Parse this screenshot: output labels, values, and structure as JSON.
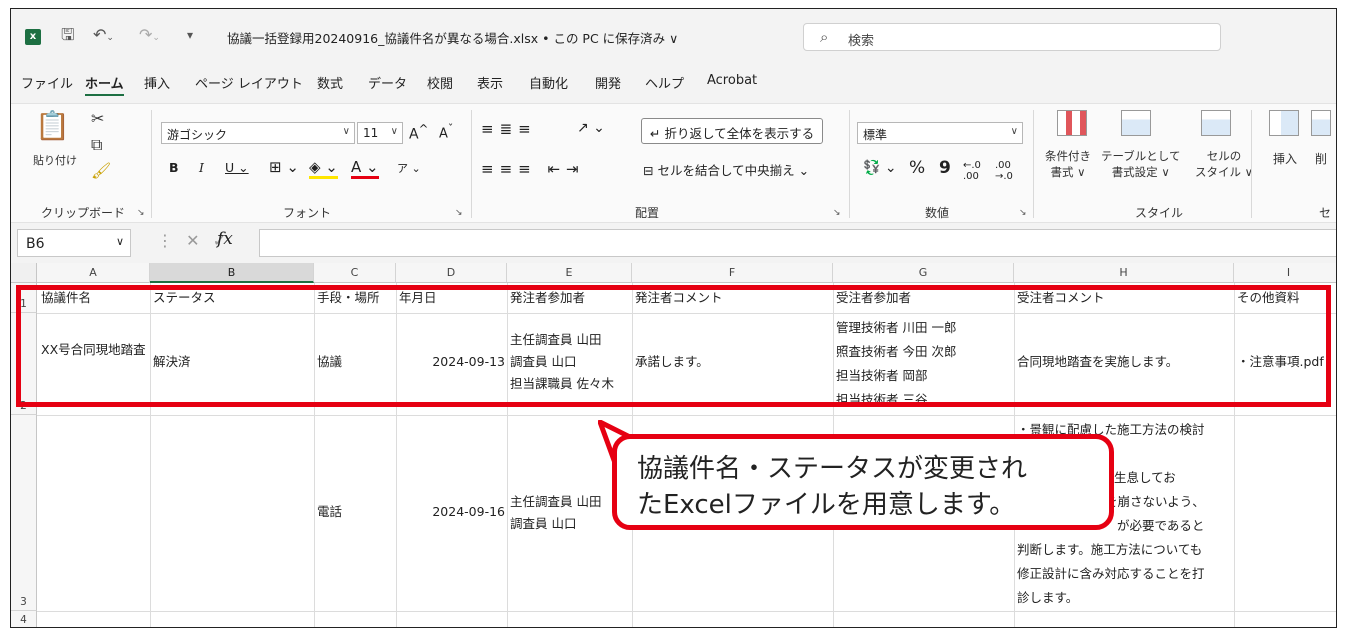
{
  "titlebar": {
    "app_icon": "excel-icon",
    "title": "協議一括登録用20240916_協議件名が異なる場合.xlsx • この PC に保存済み ∨",
    "search_placeholder": "検索"
  },
  "menu": {
    "items": [
      "ファイル",
      "ホーム",
      "挿入",
      "ページ レイアウト",
      "数式",
      "データ",
      "校閲",
      "表示",
      "自動化",
      "開発",
      "ヘルプ",
      "Acrobat"
    ],
    "active": "ホーム"
  },
  "ribbon": {
    "clipboard": {
      "paste_label": "貼り付け",
      "group_label": "クリップボード"
    },
    "font": {
      "font_name": "游ゴシック",
      "font_size": "11",
      "group_label": "フォント"
    },
    "alignment": {
      "wrap_text": "折り返して全体を表示する",
      "merge_center": "セルを結合して中央揃え",
      "group_label": "配置"
    },
    "number": {
      "format": "標準",
      "group_label": "数値"
    },
    "styles": {
      "conditional_line1": "条件付き",
      "conditional_line2": "書式 ∨",
      "table_line1": "テーブルとして",
      "table_line2": "書式設定 ∨",
      "cell_line1": "セルの",
      "cell_line2": "スタイル ∨",
      "group_label": "スタイル"
    },
    "cells": {
      "insert_label": "挿入",
      "delete_label": "削",
      "group_label": "セ"
    }
  },
  "formula_bar": {
    "name_box": "B6",
    "fx": "fx",
    "content": ""
  },
  "sheet": {
    "columns": [
      "A",
      "B",
      "C",
      "D",
      "E",
      "F",
      "G",
      "H",
      "I"
    ],
    "selected_column": "B",
    "row_numbers": [
      "1",
      "2",
      "3",
      "4"
    ],
    "header_row": [
      "協議件名",
      "ステータス",
      "手段・場所",
      "年月日",
      "発注者参加者",
      "発注者コメント",
      "受注者参加者",
      "受注者コメント",
      "その他資料"
    ],
    "row2": {
      "A": "XX号合同現地踏査",
      "B": "解決済",
      "C": "協議",
      "D": "2024-09-13",
      "E": [
        "主任調査員 山田",
        "調査員 山口",
        "担当課職員 佐々木"
      ],
      "F": "承諾します。",
      "G": [
        "管理技術者 川田 一郎",
        "照査技術者 今田 次郎",
        "担当技術者 岡部",
        "担当技術者 三谷"
      ],
      "H": "合同現地踏査を実施します。",
      "I": "・注意事項.pdf"
    },
    "row3": {
      "C": "電話",
      "D": "2024-09-16",
      "E": [
        "主任調査員 山田",
        "調査員 山口"
      ],
      "H": [
        "・景観に配慮した施工方法の検討",
        "",
        "入が生息してお",
        "を崩さないよう、",
        "が必要であると",
        "判断します。施工方法についても",
        "修正設計に含み対応することを打",
        "診します。"
      ]
    }
  },
  "callout": {
    "line1": "協議件名・ステータスが変更され",
    "line2": "たExcelファイルを用意します。"
  },
  "colors": {
    "annotation": "#e60012",
    "excel_green": "#1d6f42"
  }
}
